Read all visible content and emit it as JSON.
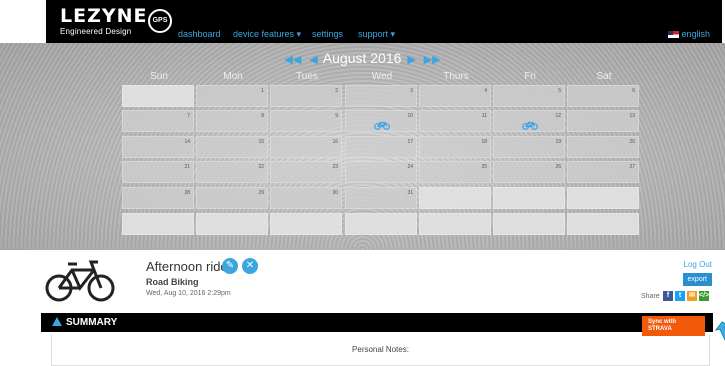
{
  "brand": {
    "logo_text": "LEZYNE",
    "tagline": "Engineered Design",
    "badge": "GPS ROOT"
  },
  "nav": {
    "dashboard": "dashboard",
    "device_features": "device features ▾",
    "settings": "settings",
    "support": "support ▾",
    "language": "english"
  },
  "calendar": {
    "month_label": "August 2016",
    "prev_year": "◀◀",
    "prev_month": "◀",
    "next_month": "▶",
    "next_year": "▶▶",
    "weekdays": [
      "Sun",
      "Mon",
      "Tues",
      "Wed",
      "Thurs",
      "Fri",
      "Sat"
    ],
    "days": [
      "1",
      "2",
      "3",
      "4",
      "5",
      "6",
      "7",
      "8",
      "9",
      "10",
      "11",
      "12",
      "13",
      "14",
      "15",
      "16",
      "17",
      "18",
      "19",
      "20",
      "21",
      "22",
      "23",
      "24",
      "25",
      "26",
      "27",
      "28",
      "29",
      "30",
      "31"
    ],
    "ride_days": [
      "10",
      "12"
    ]
  },
  "ride": {
    "title": "Afternoon ride",
    "type": "Road Biking",
    "date": "Wed, Aug 10, 2016 2:29pm"
  },
  "actions": {
    "log_out": "Log Out",
    "export": "export",
    "share": "Share"
  },
  "summary": {
    "label": "SUMMARY",
    "sync_button": "Sync with STRAVA",
    "personal_notes": "Personal Notes:"
  },
  "colors": {
    "accent": "#3aa6e0",
    "sync": "#f25a0a",
    "nav_bg": "#000000"
  },
  "icons": [
    "gps-badge-icon",
    "flag-icon",
    "bicycle-icon",
    "edit-icon",
    "delete-icon",
    "facebook-icon",
    "twitter-icon",
    "email-icon",
    "embed-icon",
    "pointer-arrow-icon"
  ]
}
